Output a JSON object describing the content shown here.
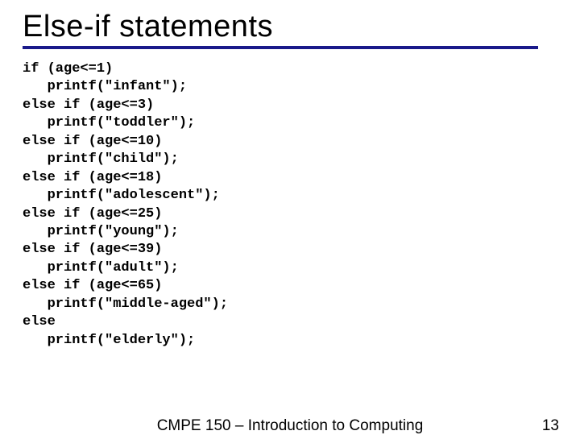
{
  "title": "Else-if statements",
  "code": "if (age<=1)\n   printf(\"infant\");\nelse if (age<=3)\n   printf(\"toddler\");\nelse if (age<=10)\n   printf(\"child\");\nelse if (age<=18)\n   printf(\"adolescent\");\nelse if (age<=25)\n   printf(\"young\");\nelse if (age<=39)\n   printf(\"adult\");\nelse if (age<=65)\n   printf(\"middle-aged\");\nelse\n   printf(\"elderly\");",
  "footer": {
    "course": "CMPE 150 – Introduction to Computing",
    "page": "13"
  }
}
